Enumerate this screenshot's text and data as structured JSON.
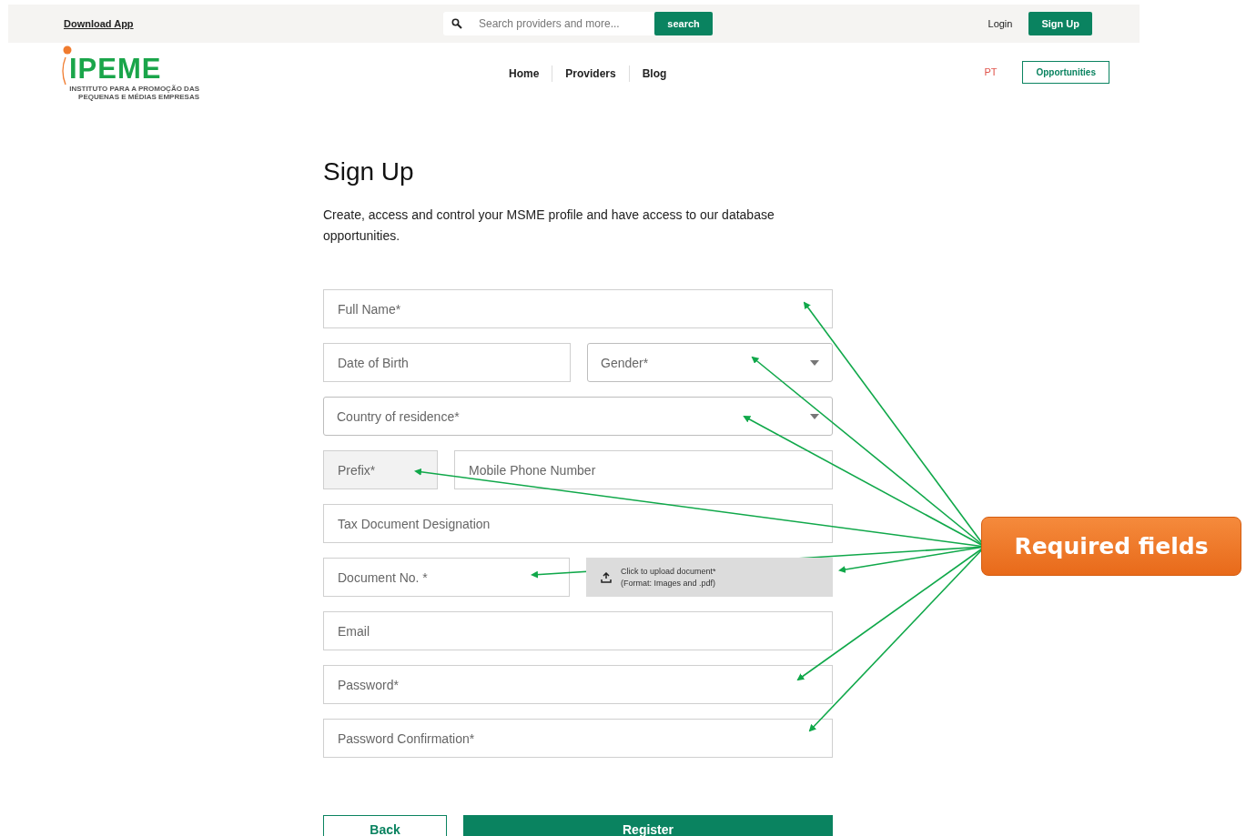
{
  "top_bar": {
    "download_link": "Download App",
    "search": {
      "placeholder": "Search providers and more..."
    },
    "search_button": "search",
    "login": "Login",
    "signup_button": "Sign Up"
  },
  "logo": {
    "name": "IPEME",
    "subtitle": [
      "INSTITUTO PARA A PROMOÇÃO DAS",
      "PEQUENAS E MÉDIAS EMPRESAS"
    ]
  },
  "nav": {
    "items": [
      "Home",
      "Providers",
      "Blog"
    ],
    "language": "PT",
    "opportunities_button": "Opportunities"
  },
  "form": {
    "title": "Sign Up",
    "description": "Create, access and control your MSME profile and have access to our database opportunities.",
    "rows": [
      [
        {
          "kind": "text",
          "placeholder": "Full Name*",
          "disabled": false
        }
      ],
      [
        {
          "kind": "text",
          "placeholder": "Date of Birth",
          "disabled": false
        },
        {
          "kind": "select",
          "placeholder": "Gender*",
          "disabled": false
        }
      ],
      [
        {
          "kind": "select",
          "placeholder": "Country of residence*",
          "disabled": false
        }
      ],
      [
        {
          "kind": "text",
          "placeholder": "Prefix*",
          "disabled": true
        },
        {
          "kind": "text",
          "placeholder": "Mobile Phone Number",
          "disabled": false
        }
      ],
      [
        {
          "kind": "text",
          "placeholder": "Tax Document Designation",
          "disabled": false
        }
      ],
      [
        {
          "kind": "text",
          "placeholder": "Document No. *",
          "disabled": false
        },
        {
          "kind": "upload",
          "lines": [
            "Click to upload document*",
            "(Format: Images and .pdf)"
          ],
          "disabled": false
        }
      ],
      [
        {
          "kind": "text",
          "placeholder": "Email",
          "disabled": false
        }
      ],
      [
        {
          "kind": "text",
          "placeholder": "Password*",
          "disabled": false
        }
      ],
      [
        {
          "kind": "text",
          "placeholder": "Password Confirmation*",
          "disabled": false
        }
      ]
    ],
    "buttons": [
      {
        "label": "Back",
        "kind": "secondary"
      },
      {
        "label": "Register",
        "kind": "primary"
      }
    ]
  },
  "annotation": {
    "label": "Required fields"
  }
}
